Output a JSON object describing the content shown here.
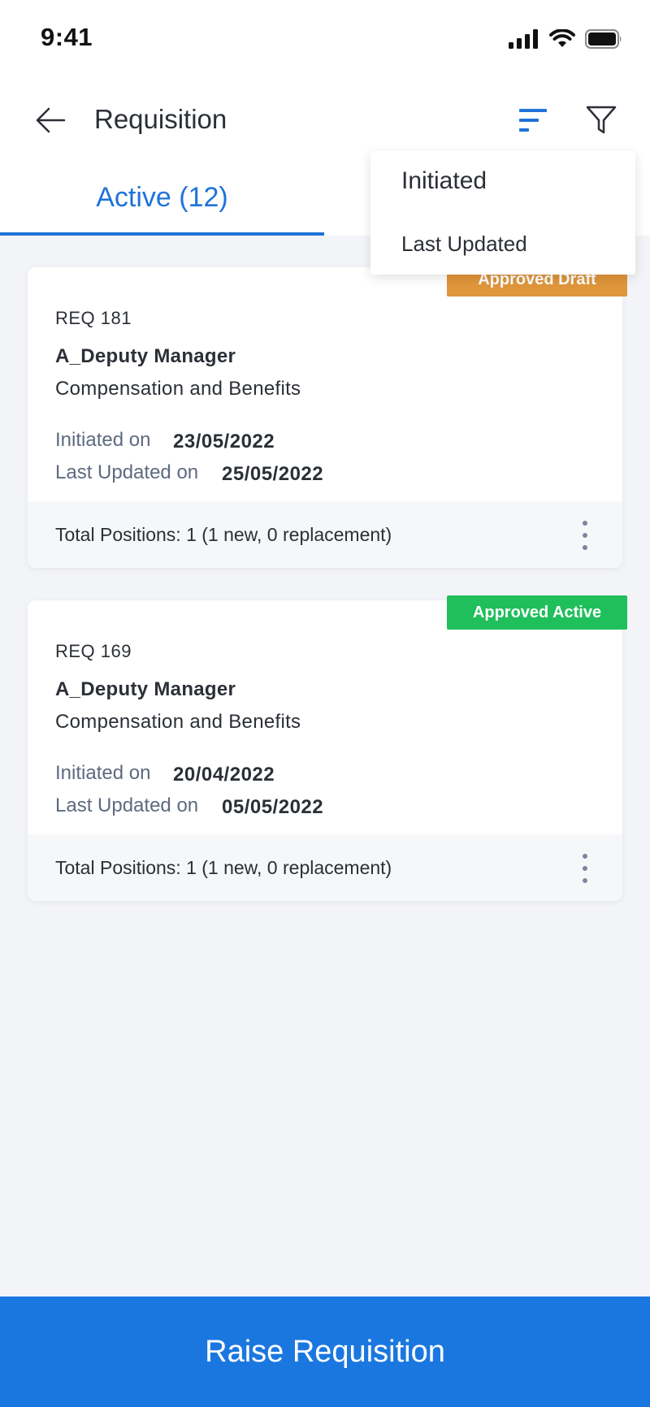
{
  "status_bar": {
    "time": "9:41",
    "icons": [
      "cellular-signal-icon",
      "wifi-icon",
      "battery-icon"
    ]
  },
  "header": {
    "title": "Requisition",
    "back_icon": "arrow-left-icon",
    "sort_icon": "sort-icon",
    "filter_icon": "filter-funnel-icon"
  },
  "tabs": [
    {
      "label": "Active (12)",
      "active": true
    }
  ],
  "sort_menu": {
    "items": [
      "Initiated",
      "Last Updated"
    ]
  },
  "cards": [
    {
      "badge": "Approved Draft",
      "badge_color": "#e0963b",
      "id": "REQ 181",
      "role": "A_Deputy Manager",
      "department": "Compensation and Benefits",
      "initiated_label": "Initiated on",
      "initiated_date": "23/05/2022",
      "updated_label": "Last Updated on",
      "updated_date": "25/05/2022",
      "positions": "Total Positions: 1 (1 new, 0 replacement)"
    },
    {
      "badge": "Approved Active",
      "badge_color": "#1fbf5b",
      "id": "REQ 169",
      "role": "A_Deputy Manager",
      "department": "Compensation and Benefits",
      "initiated_label": "Initiated on",
      "initiated_date": "20/04/2022",
      "updated_label": "Last Updated on",
      "updated_date": "05/05/2022",
      "positions": "Total Positions: 1 (1 new, 0 replacement)"
    }
  ],
  "action": {
    "raise_label": "Raise Requisition"
  },
  "colors": {
    "accent": "#1f73d9",
    "primary_button": "#1b77e0",
    "background": "#f3f4f8"
  }
}
